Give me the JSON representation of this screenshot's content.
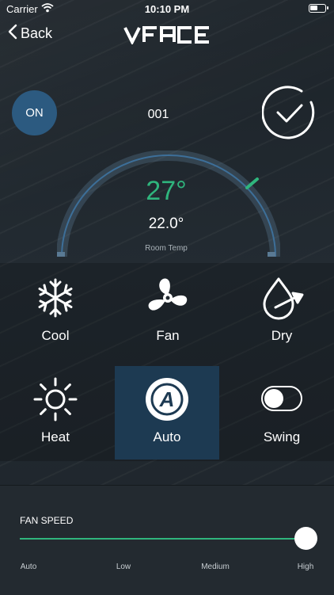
{
  "status_bar": {
    "carrier": "Carrier",
    "time": "10:10 PM"
  },
  "nav": {
    "back_label": "Back",
    "logo_text": "VFACE"
  },
  "power": {
    "label": "ON"
  },
  "device": {
    "id": "001"
  },
  "temperature": {
    "set": "27°",
    "room": "22.0°",
    "room_label": "Room Temp"
  },
  "modes": [
    {
      "label": "Cool",
      "icon": "snowflake-icon"
    },
    {
      "label": "Fan",
      "icon": "fan-icon"
    },
    {
      "label": "Dry",
      "icon": "droplet-icon"
    },
    {
      "label": "Heat",
      "icon": "sun-icon"
    },
    {
      "label": "Auto",
      "icon": "auto-a-icon",
      "active": true
    },
    {
      "label": "Swing",
      "icon": "toggle-switch"
    }
  ],
  "fan_speed": {
    "title": "FAN SPEED",
    "levels": [
      "Auto",
      "Low",
      "Medium",
      "High"
    ],
    "selected": "High"
  },
  "colors": {
    "accent": "#2fb57d",
    "active_tile": "#1d3a52",
    "on_button": "#2c5a80"
  }
}
